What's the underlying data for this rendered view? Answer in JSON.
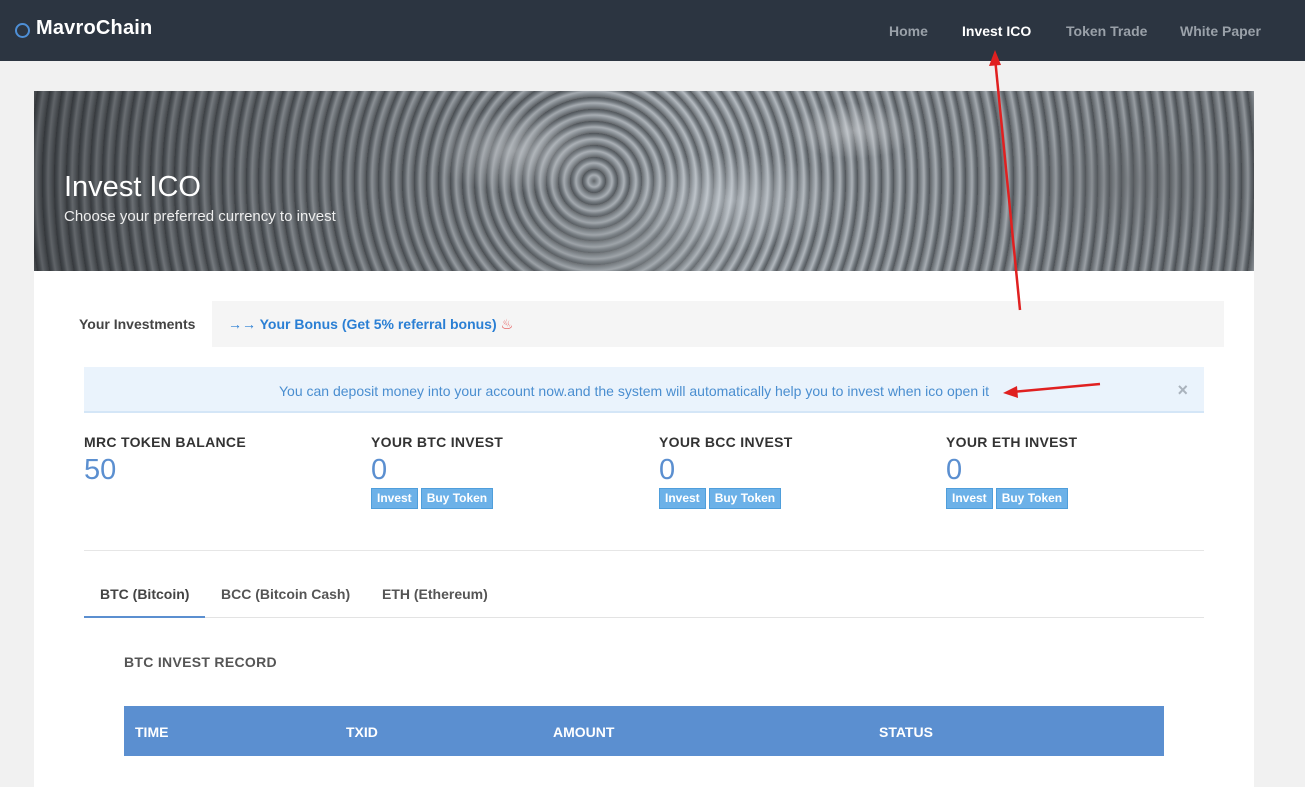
{
  "navbar": {
    "brand": "MavroChain",
    "links": [
      "Home",
      "Invest ICO",
      "Token Trade",
      "White Paper"
    ],
    "active": "Invest ICO"
  },
  "hero": {
    "title": "Invest ICO",
    "subtitle": "Choose your preferred currency to invest"
  },
  "investments": {
    "label": "Your Investments",
    "bonus_link": "→→ Your Bonus (Get 5% referral bonus)"
  },
  "alert": {
    "text": "You can deposit money into your account now.and the system will automatically help you to invest when ico open it",
    "close": "×"
  },
  "stats": [
    {
      "label": "MRC TOKEN BALANCE",
      "value": "50"
    },
    {
      "label": "YOUR BTC INVEST",
      "value": "0",
      "btn1": "Invest",
      "btn2": "Buy Token"
    },
    {
      "label": "YOUR BCC INVEST",
      "value": "0",
      "btn1": "Invest",
      "btn2": "Buy Token"
    },
    {
      "label": "YOUR ETH INVEST",
      "value": "0",
      "btn1": "Invest",
      "btn2": "Buy Token"
    }
  ],
  "tabs": [
    "BTC (Bitcoin)",
    "BCC (Bitcoin Cash)",
    "ETH (Ethereum)"
  ],
  "record": {
    "title": "BTC INVEST RECORD",
    "columns": [
      "TIME",
      "TXID",
      "AMOUNT",
      "STATUS"
    ]
  },
  "colors": {
    "navbar": "#2c3541",
    "accent": "#5b8fd0",
    "button": "#6cb1e8",
    "annotation": "#e02020"
  }
}
